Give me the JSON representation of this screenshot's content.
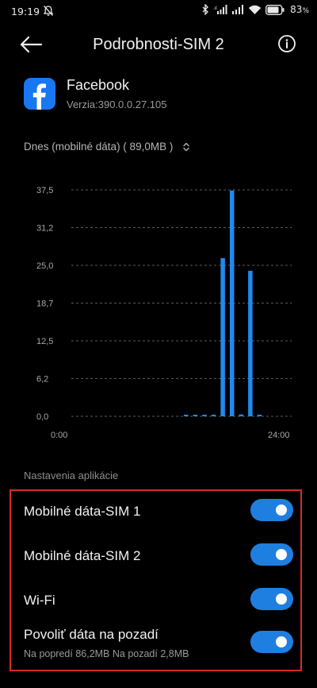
{
  "status_bar": {
    "time": "19:19",
    "battery_percent": "83"
  },
  "header": {
    "title": "Podrobnosti-SIM 2"
  },
  "app": {
    "name": "Facebook",
    "version": "Verzia:390.0.0.27.105"
  },
  "period": {
    "label": "Dnes (mobilné dáta) ( 89,0MB )"
  },
  "chart_data": {
    "type": "bar",
    "y_ticks": [
      "37,5",
      "31,2",
      "25,0",
      "18,7",
      "12,5",
      "6,2",
      "0,0"
    ],
    "x_start_label": "0:00",
    "x_end_label": "24:00",
    "ylim": [
      0,
      37.5
    ],
    "values": [
      0,
      0,
      0,
      0,
      0,
      0,
      0,
      0,
      0,
      0,
      0,
      0,
      0.05,
      0.05,
      0.05,
      0.05,
      26.2,
      37.4,
      0.3,
      24.1,
      0.1,
      0,
      0,
      0
    ],
    "bar_color": "#1f8af0",
    "grid": true
  },
  "settings": {
    "section_label": "Nastavenia aplikácie",
    "items": [
      {
        "label": "Mobilné dáta-SIM 1",
        "enabled": true
      },
      {
        "label": "Mobilné dáta-SIM 2",
        "enabled": true
      },
      {
        "label": "Wi-Fi",
        "enabled": true
      },
      {
        "label": "Povoliť dáta na pozadí",
        "sub": "Na popredí 86,2MB  Na pozadí 2,8MB",
        "enabled": true
      }
    ]
  },
  "icons": {
    "status_left": [
      "muted-notifications-icon"
    ],
    "status_right": [
      "bluetooth-icon",
      "signal-sim1-icon",
      "signal-sim2-icon",
      "wifi-icon",
      "battery-icon"
    ],
    "header": [
      "back-arrow-icon",
      "info-icon"
    ],
    "period": "chevron-up-down-icon"
  },
  "colors": {
    "accent": "#1f7fe0",
    "highlight_border": "#d62a2a",
    "background": "#000000"
  }
}
